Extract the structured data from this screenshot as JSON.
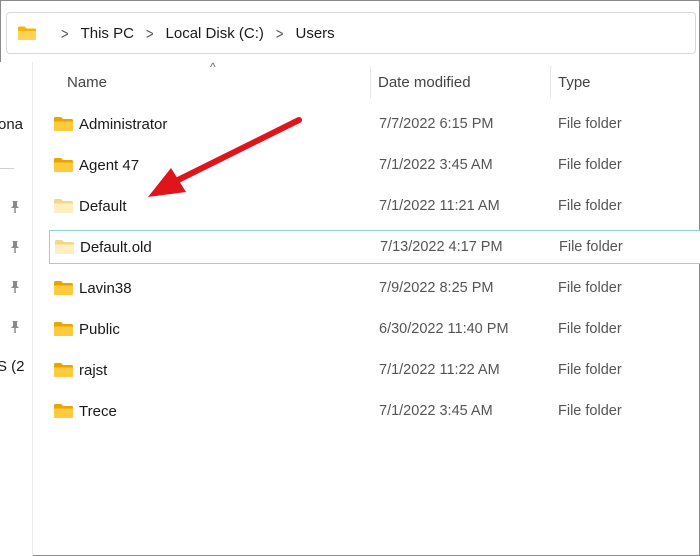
{
  "breadcrumb": {
    "items": [
      "This PC",
      "Local Disk (C:)",
      "Users"
    ]
  },
  "left_nav": {
    "stubs": [
      "ona",
      "S (2"
    ]
  },
  "columns": {
    "name": "Name",
    "date": "Date modified",
    "type": "Type"
  },
  "rows": [
    {
      "name": "Administrator",
      "date": "7/7/2022 6:15 PM",
      "type": "File folder"
    },
    {
      "name": "Agent 47",
      "date": "7/1/2022 3:45 AM",
      "type": "File folder"
    },
    {
      "name": "Default",
      "date": "7/1/2022 11:21 AM",
      "type": "File folder"
    },
    {
      "name": "Default.old",
      "date": "7/13/2022 4:17 PM",
      "type": "File folder"
    },
    {
      "name": "Lavin38",
      "date": "7/9/2022 8:25 PM",
      "type": "File folder"
    },
    {
      "name": "Public",
      "date": "6/30/2022 11:40 PM",
      "type": "File folder"
    },
    {
      "name": "rajst",
      "date": "7/1/2022 11:22 AM",
      "type": "File folder"
    },
    {
      "name": "Trece",
      "date": "7/1/2022 3:45 AM",
      "type": "File folder"
    }
  ],
  "colors": {
    "folder_yellow": "#f7c948",
    "folder_light": "#fbe7a8",
    "selection_border": "#8fd3e2",
    "annotation_red": "#e0141b"
  },
  "icons": {
    "breadcrumb_folder": "folder-icon",
    "chevron": "chevron-right-icon",
    "pin": "pin-icon",
    "sort": "sort-up-caret-icon"
  }
}
